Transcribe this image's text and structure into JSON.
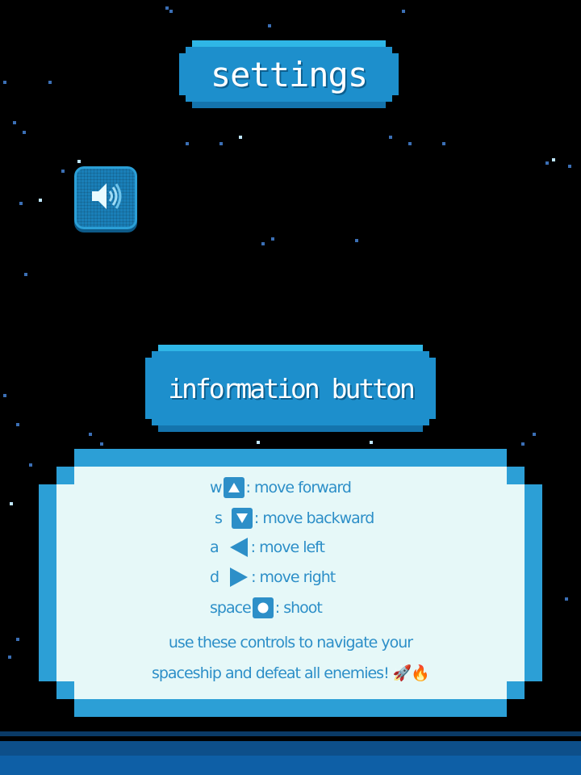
{
  "header": {
    "settings_label": "settings"
  },
  "sound": {
    "icon": "speaker-icon"
  },
  "info": {
    "button_label": "information button"
  },
  "controls": [
    {
      "key": "w",
      "icon": "arrow-up-icon",
      "action": ": move forward"
    },
    {
      "key": "s",
      "icon": "arrow-down-icon",
      "action": ": move backward"
    },
    {
      "key": "a",
      "icon": "arrow-left-icon",
      "action": ": move left"
    },
    {
      "key": "d",
      "icon": "arrow-right-icon",
      "action": ": move right"
    },
    {
      "key": "space",
      "icon": "circle-button-icon",
      "action": ": shoot"
    }
  ],
  "description": {
    "line1": "use these controls to navigate your",
    "line2": "spaceship and defeat all enemies! 🚀🔥"
  },
  "colors": {
    "background": "#000000",
    "button": "#1d8fcc",
    "panel_border": "#2c9fd6",
    "panel_fill": "#e6f8f8",
    "text_accent": "#2d8fc8"
  }
}
